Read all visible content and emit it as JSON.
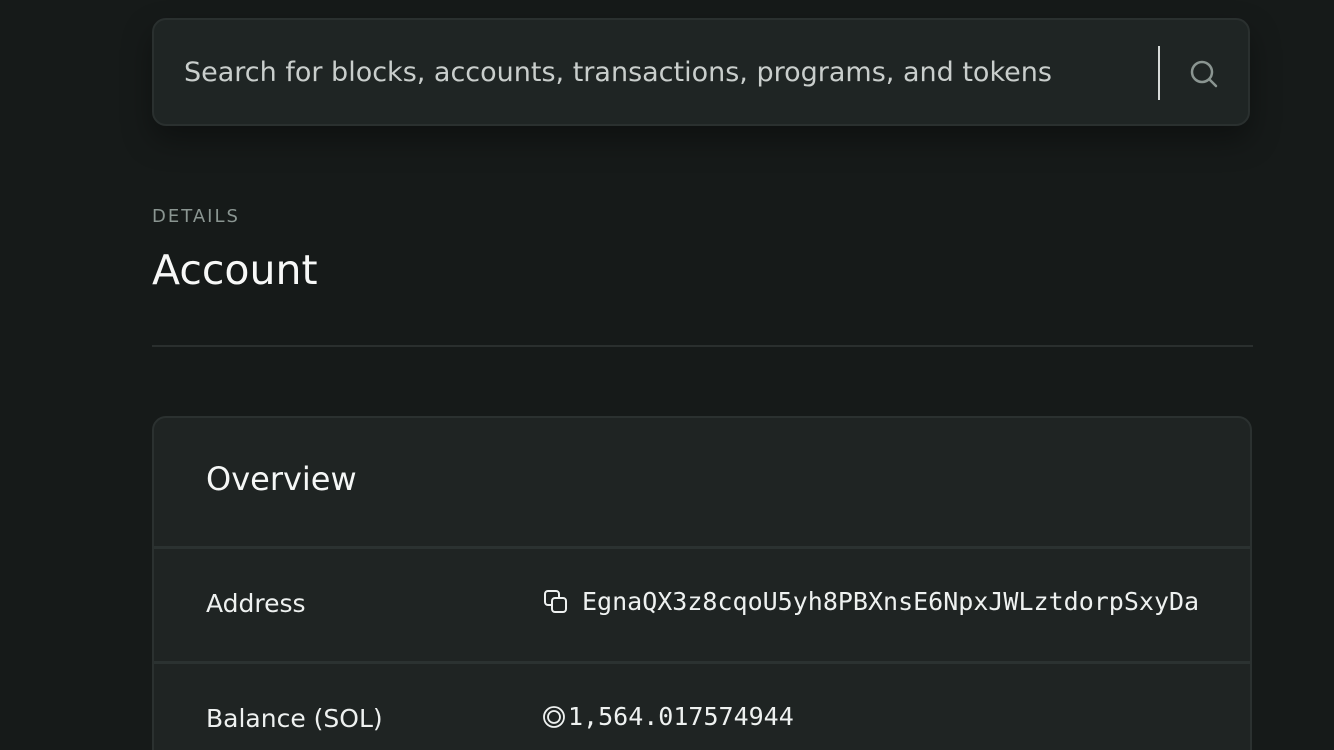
{
  "search": {
    "placeholder": "Search for blocks, accounts, transactions, programs, and tokens",
    "icon": "search-icon"
  },
  "header": {
    "pretitle": "DETAILS",
    "title": "Account"
  },
  "overview": {
    "title": "Overview",
    "rows": [
      {
        "label": "Address",
        "value": "EgnaQX3z8cqoU5yh8PBXnsE6NpxJWLztdorpSxyDa",
        "icon": "copy-icon"
      },
      {
        "label": "Balance (SOL)",
        "value": "1,564.017574944",
        "icon": "sol-icon"
      }
    ]
  },
  "colors": {
    "background": "#161a19",
    "card": "#1f2423",
    "muted_text": "#8a9591"
  }
}
